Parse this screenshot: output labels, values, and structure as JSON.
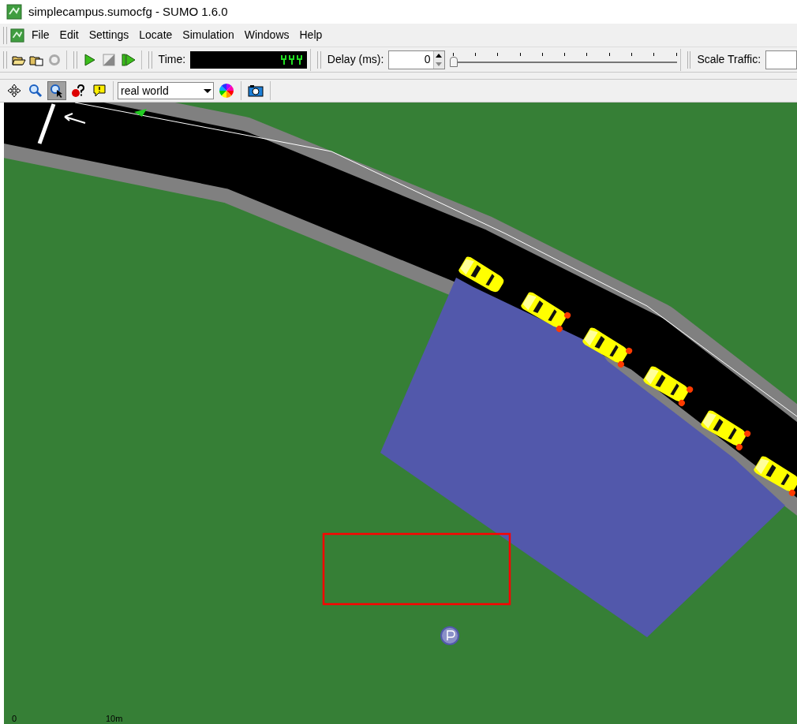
{
  "window": {
    "title": "simplecampus.sumocfg - SUMO 1.6.0"
  },
  "menu": [
    "File",
    "Edit",
    "Settings",
    "Locate",
    "Simulation",
    "Windows",
    "Help"
  ],
  "toolbar": {
    "time_label": "Time:",
    "delay_label": "Delay (ms):",
    "delay_value": "0",
    "delay_slider": {
      "level": 0
    },
    "scale_label": "Scale Traffic:"
  },
  "view_toolbar": {
    "tools": [
      {
        "kind": "move",
        "selected": false
      },
      {
        "kind": "zoom",
        "selected": false
      },
      {
        "kind": "select",
        "selected": true
      },
      {
        "kind": "query",
        "selected": false
      },
      {
        "kind": "message",
        "selected": false
      }
    ],
    "scheme": "real world"
  },
  "map": {
    "vehicles": [
      {
        "braking": false
      },
      {
        "braking": true
      },
      {
        "braking": true
      },
      {
        "braking": true
      },
      {
        "braking": true
      },
      {
        "braking": true
      }
    ],
    "scale": [
      "0",
      "10m"
    ]
  }
}
